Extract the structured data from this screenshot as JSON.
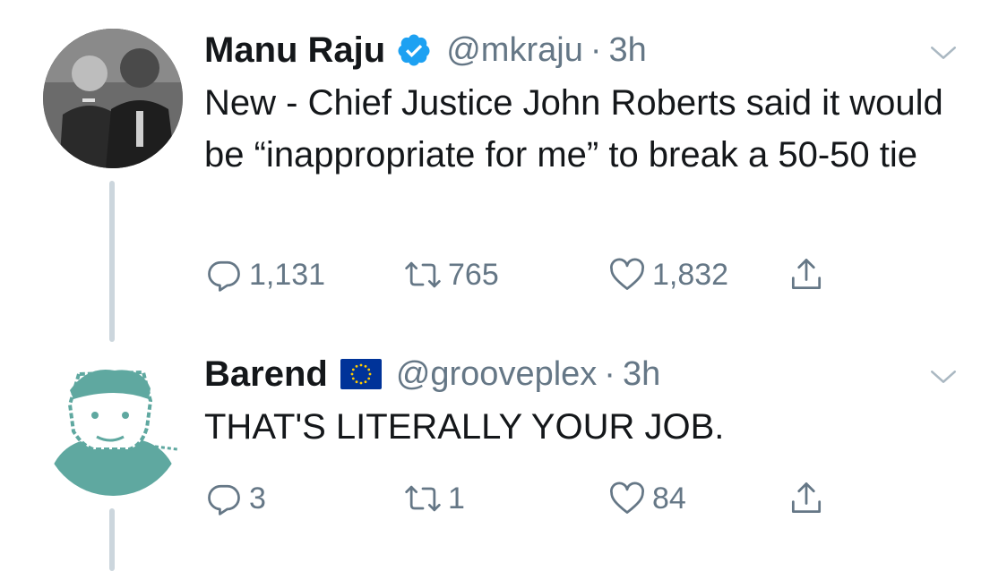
{
  "tweets": [
    {
      "name": "Manu Raju",
      "handle": "@mkraju",
      "time": "3h",
      "text": "New - Chief Justice John Roberts said it would be “inappropriate for me” to break a 50-50 tie",
      "replies": "1,131",
      "retweets": "765",
      "likes": "1,832",
      "verified": true
    },
    {
      "name": "Barend",
      "handle": "@grooveplex",
      "time": "3h",
      "text": "THAT'S LITERALLY YOUR JOB.",
      "replies": "3",
      "retweets": "1",
      "likes": "84",
      "flag": "eu-flag-icon"
    }
  ],
  "colors": {
    "text": "#14171a",
    "muted": "#657786",
    "verified": "#1da1f2",
    "thread_line": "#ccd6dd",
    "avatar_teal": "#5fa8a0"
  }
}
